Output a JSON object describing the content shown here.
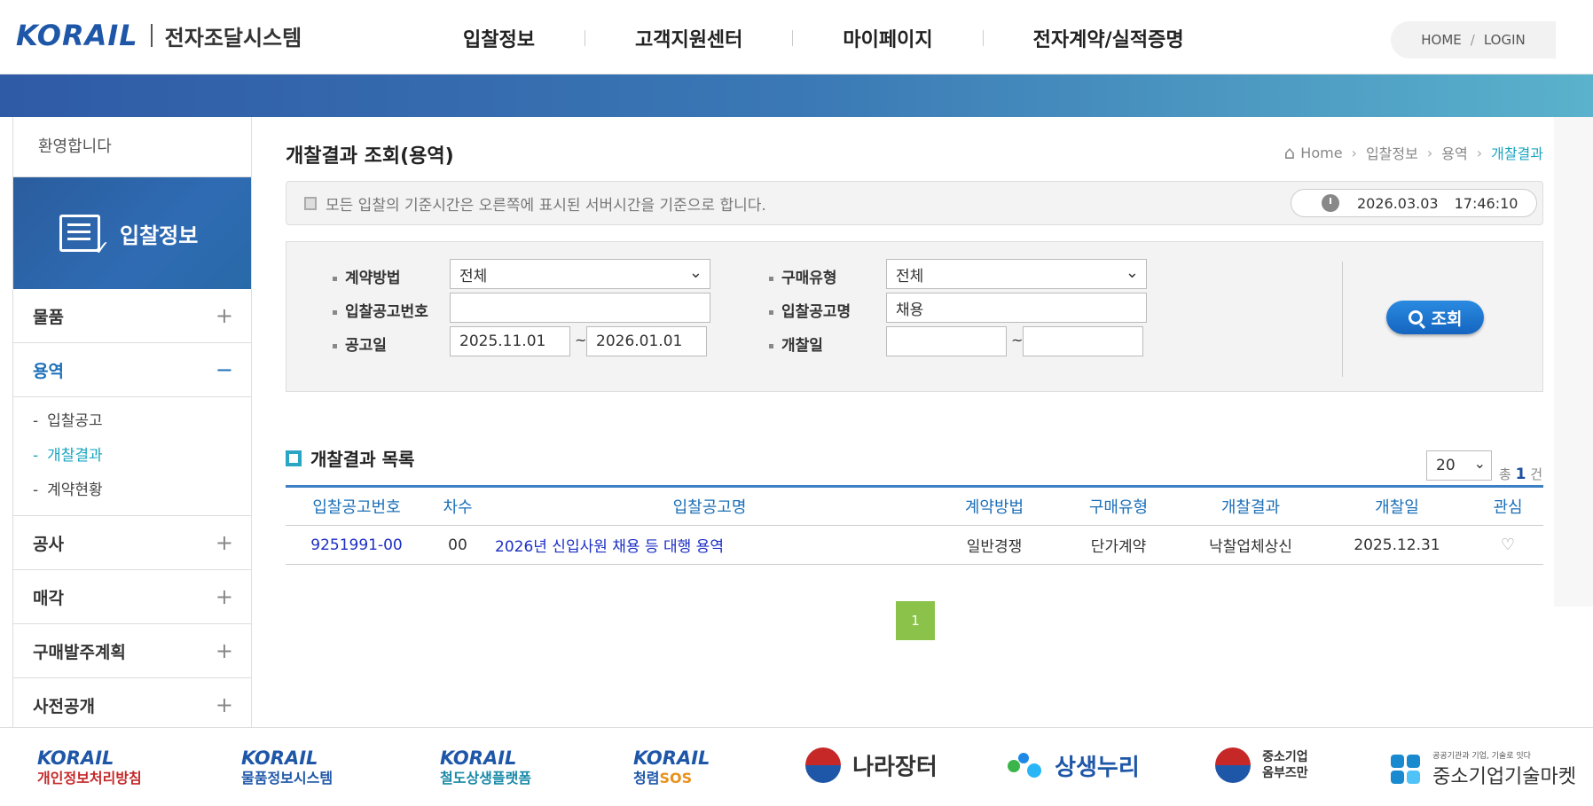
{
  "header": {
    "logo": "KORAIL",
    "system_name": "전자조달시스템",
    "nav": [
      "입찰정보",
      "고객지원센터",
      "마이페이지",
      "전자계약/실적증명"
    ],
    "util_home": "HOME",
    "util_sep": "/",
    "util_login": "LOGIN"
  },
  "sidebar": {
    "welcome": "환영합니다",
    "title": "입찰정보",
    "menu_goods": "물품",
    "menu_service": "용역",
    "sub": [
      "입찰공고",
      "개찰결과",
      "계약현황"
    ],
    "menu_construction": "공사",
    "menu_sale": "매각",
    "menu_plan": "구매발주계획",
    "menu_prior": "사전공개",
    "plus": "+",
    "minus": "−",
    "dash": "-"
  },
  "main": {
    "title": "개찰결과 조회(용역)",
    "breadcrumb": [
      "Home",
      "입찰정보",
      "용역",
      "개찰결과"
    ],
    "notice": "모든 입찰의 기준시간은 오른쪽에 표시된 서버시간을 기준으로 합니다.",
    "server_date": "2026.03.03",
    "server_time": "17:46:10"
  },
  "search": {
    "contract_method_label": "계약방법",
    "contract_method_value": "전체",
    "purchase_type_label": "구매유형",
    "purchase_type_value": "전체",
    "bid_no_label": "입찰공고번호",
    "bid_no_value": "",
    "bid_name_label": "입찰공고명",
    "bid_name_value": "채용",
    "notice_date_label": "공고일",
    "notice_date_from": "2025.11.01",
    "notice_date_to": "2026.01.01",
    "open_date_label": "개찰일",
    "open_date_from": "",
    "open_date_to": "",
    "tilde": "~",
    "button": "조회"
  },
  "list": {
    "title": "개찰결과 목록",
    "page_size": "20",
    "total_prefix": "총",
    "total_count": "1",
    "total_suffix": "건",
    "columns": [
      "입찰공고번호",
      "차수",
      "입찰공고명",
      "계약방법",
      "구매유형",
      "개찰결과",
      "개찰일",
      "관심"
    ],
    "rows": [
      {
        "bid_no": "9251991-00",
        "round": "00",
        "name": "2026년 신입사원 채용 등 대행 용역",
        "method": "일반경쟁",
        "type": "단가계약",
        "result": "낙찰업체상신",
        "date": "2025.12.31"
      }
    ],
    "page": "1"
  },
  "footer": {
    "korail": "KORAIL",
    "privacy": "개인정보처리방침",
    "goods_info": "물품정보시스템",
    "rail_platform": "철도상생플랫폼",
    "cheongryeom": "청렴",
    "sos": "SOS",
    "nara": "나라장터",
    "sangsaeng": "상생누리",
    "sme_line1": "중소기업",
    "sme_line2": "옴부즈만",
    "tech_small": "공공기관과 기업, 기술로 잇다",
    "tech": "중소기업기술마켓"
  }
}
